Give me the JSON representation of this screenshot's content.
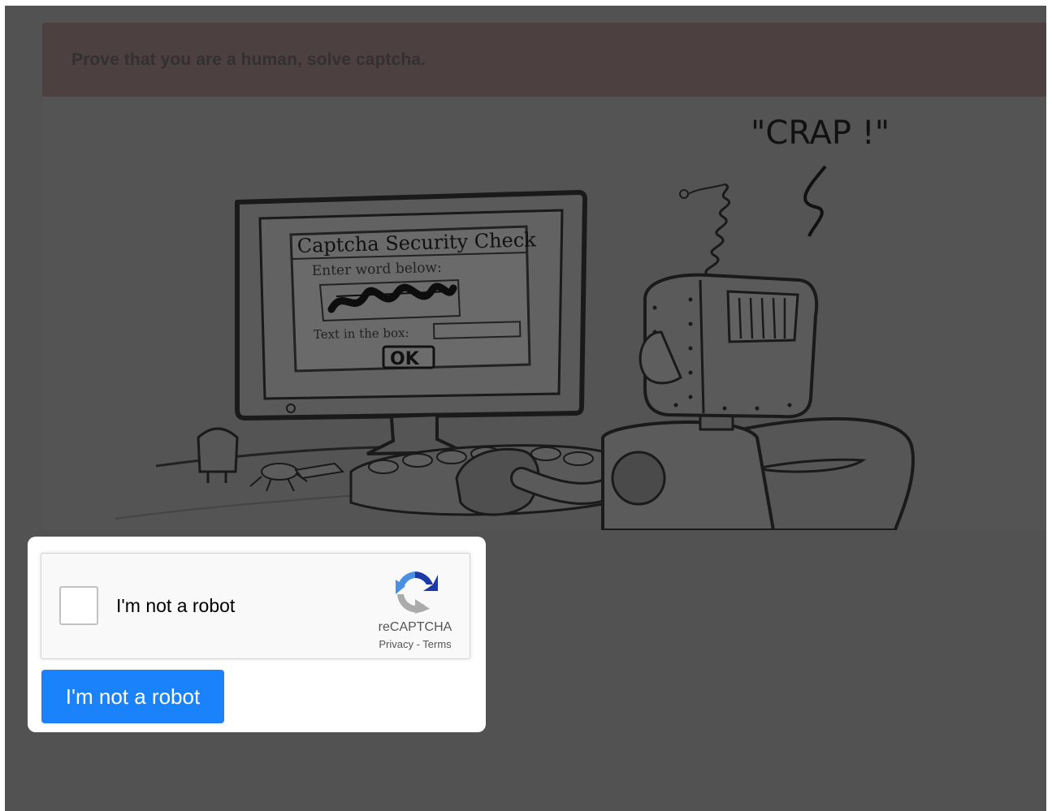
{
  "alert": {
    "text": "Prove that you are a human, solve captcha."
  },
  "comic": {
    "speech": "\"CRAP !\"",
    "dialog_title": "Captcha Security Check",
    "dialog_prompt": "Enter word below:",
    "dialog_field_label": "Text in the box:",
    "dialog_ok": "OK"
  },
  "recaptcha": {
    "checkbox_label": "I'm not a robot",
    "brand": "reCAPTCHA",
    "privacy": "Privacy",
    "separator": " - ",
    "terms": "Terms",
    "logo_icon": "recaptcha-logo-icon"
  },
  "submit": {
    "label": "I'm not a robot"
  },
  "colors": {
    "button": "#1a82fb",
    "backdrop": "#525252"
  }
}
